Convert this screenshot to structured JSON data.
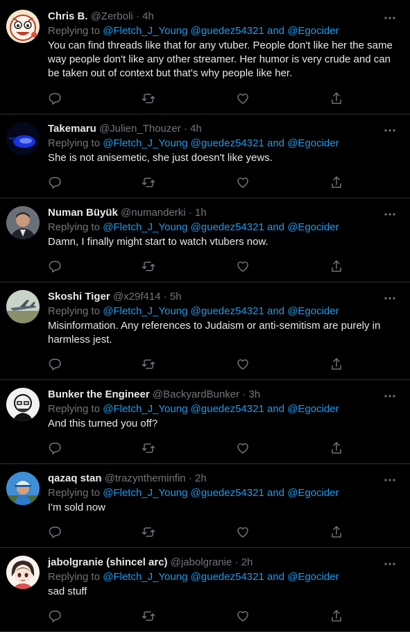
{
  "reply_prefix": "Replying to",
  "mentions": [
    "@Fletch_J_Young",
    "@guedez54321",
    "and",
    "@Egocider"
  ],
  "tweets": [
    {
      "name": "Chris B.",
      "handle": "@Zerboli",
      "time": "4h",
      "text": "You can find threads like that for any vtuber. People don't like her the same way people don't like any other streamer. Her humor is very crude and can be taken out of context but that's why people like her.",
      "avatar": "cartoon-avatar"
    },
    {
      "name": "Takemaru",
      "handle": "@Julien_Thouzer",
      "time": "4h",
      "text": "She is not anisemetic, she just doesn't like yews.",
      "avatar": "dark-blue-avatar"
    },
    {
      "name": "Numan Büyük",
      "handle": "@numanderki",
      "time": "1h",
      "text": "Damn, I finally might start to watch vtubers now.",
      "avatar": "man-suit-avatar"
    },
    {
      "name": "Skoshi Tiger",
      "handle": "@x29f414",
      "time": "5h",
      "text": "Misinformation. Any references to Judaism or anti-semitism are purely in harmless jest.",
      "avatar": "jet-avatar"
    },
    {
      "name": "Bunker the Engineer",
      "handle": "@BackyardBunker",
      "time": "3h",
      "text": "And this turned you off?",
      "avatar": "sketch-face-avatar"
    },
    {
      "name": "qazaq stan",
      "handle": "@trazyntheminfin",
      "time": "2h",
      "text": "I'm sold now",
      "avatar": "blue-hat-avatar"
    },
    {
      "name": "jabolgranie (shincel arc)",
      "handle": "@jabolgranie",
      "time": "2h",
      "text": "sad stuff",
      "avatar": "anime-girl-avatar"
    }
  ],
  "icons": {
    "reply": "reply-icon",
    "retweet": "retweet-icon",
    "like": "heart-icon",
    "share": "share-icon",
    "more": "more-options-icon"
  },
  "colors": {
    "background": "#000000",
    "text": "#e7e9ea",
    "muted": "#71767b",
    "link": "#1d9bf0",
    "divider": "#2f3336"
  }
}
